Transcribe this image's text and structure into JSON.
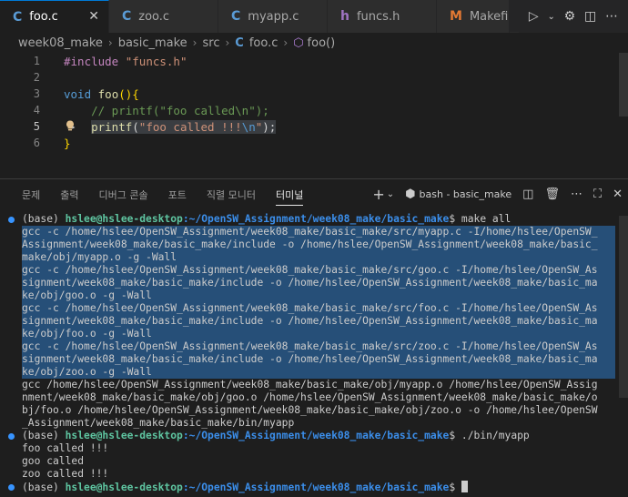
{
  "tabs": [
    {
      "icon": "C",
      "name": "foo.c",
      "active": true
    },
    {
      "icon": "C",
      "name": "zoo.c"
    },
    {
      "icon": "C",
      "name": "myapp.c"
    },
    {
      "icon": "h",
      "name": "funcs.h"
    },
    {
      "icon": "M",
      "name": "Makefile"
    }
  ],
  "breadcrumb": [
    "week08_make",
    "basic_make",
    "src",
    "foo.c",
    "foo()"
  ],
  "editor": {
    "lines": [
      {
        "num": "1",
        "text": "#include \"funcs.h\""
      },
      {
        "num": "2",
        "text": ""
      },
      {
        "num": "3",
        "text": "void foo(){"
      },
      {
        "num": "4",
        "text": "    // printf(\"foo called\\n\");"
      },
      {
        "num": "5",
        "text": "    printf(\"foo called !!!\\n\");"
      },
      {
        "num": "6",
        "text": "}"
      }
    ],
    "current_line": "5"
  },
  "panel": {
    "tabs": [
      "문제",
      "출력",
      "디버그 콘솔",
      "포트",
      "직렬 모니터",
      "터미널"
    ],
    "active_tab": "터미널",
    "terminal_name": "bash - basic_make"
  },
  "terminal": {
    "prompt_prefix": "(base) ",
    "user": "hslee@hslee-desktop",
    "path": ":~/OpenSW_Assignment/week08_make/basic_make",
    "prompt_suffix": "$ ",
    "lines": [
      {
        "type": "prompt",
        "cmd": "make all"
      },
      {
        "type": "sel",
        "text": "gcc -c /home/hslee/OpenSW_Assignment/week08_make/basic_make/src/myapp.c -I/home/hslee/OpenSW_"
      },
      {
        "type": "sel",
        "text": "Assignment/week08_make/basic_make/include -o /home/hslee/OpenSW_Assignment/week08_make/basic_"
      },
      {
        "type": "sel",
        "text": "make/obj/myapp.o -g -Wall"
      },
      {
        "type": "sel",
        "text": "gcc -c /home/hslee/OpenSW_Assignment/week08_make/basic_make/src/goo.c -I/home/hslee/OpenSW_As"
      },
      {
        "type": "sel",
        "text": "signment/week08_make/basic_make/include -o /home/hslee/OpenSW_Assignment/week08_make/basic_ma"
      },
      {
        "type": "sel",
        "text": "ke/obj/goo.o -g -Wall"
      },
      {
        "type": "sel",
        "text": "gcc -c /home/hslee/OpenSW_Assignment/week08_make/basic_make/src/foo.c -I/home/hslee/OpenSW_As"
      },
      {
        "type": "sel",
        "text": "signment/week08_make/basic_make/include -o /home/hslee/OpenSW_Assignment/week08_make/basic_ma"
      },
      {
        "type": "sel",
        "text": "ke/obj/foo.o -g -Wall"
      },
      {
        "type": "sel",
        "text": "gcc -c /home/hslee/OpenSW_Assignment/week08_make/basic_make/src/zoo.c -I/home/hslee/OpenSW_As"
      },
      {
        "type": "sel",
        "text": "signment/week08_make/basic_make/include -o /home/hslee/OpenSW_Assignment/week08_make/basic_ma"
      },
      {
        "type": "sel",
        "text": "ke/obj/zoo.o -g -Wall "
      },
      {
        "type": "out",
        "text": "gcc /home/hslee/OpenSW_Assignment/week08_make/basic_make/obj/myapp.o /home/hslee/OpenSW_Assig"
      },
      {
        "type": "out",
        "text": "nment/week08_make/basic_make/obj/goo.o /home/hslee/OpenSW_Assignment/week08_make/basic_make/o"
      },
      {
        "type": "out",
        "text": "bj/foo.o /home/hslee/OpenSW_Assignment/week08_make/basic_make/obj/zoo.o -o /home/hslee/OpenSW"
      },
      {
        "type": "out",
        "text": "_Assignment/week08_make/basic_make/bin/myapp"
      },
      {
        "type": "prompt",
        "cmd": "./bin/myapp"
      },
      {
        "type": "out",
        "text": "foo called !!!"
      },
      {
        "type": "out",
        "text": "goo called"
      },
      {
        "type": "out",
        "text": "zoo called !!!"
      },
      {
        "type": "prompt",
        "cmd": ""
      }
    ]
  },
  "colors": {
    "selection": "#264f78",
    "prompt_user": "#5ec4a0",
    "prompt_path": "#3b8eea",
    "active_tab_border": "#0078d4"
  }
}
